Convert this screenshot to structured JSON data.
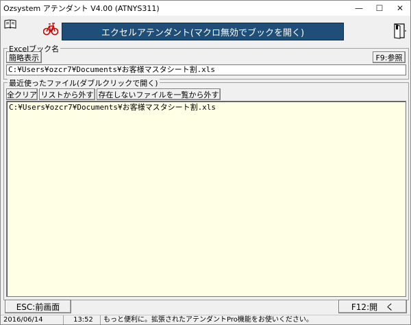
{
  "window": {
    "title": "Ozsystem アテンダント V4.00 (ATNYS311)",
    "buttons": {
      "minimize": "—",
      "maximize": "☐",
      "close": "✕"
    }
  },
  "toolbar": {
    "banner": "エクセルアテンダント(マクロ無効でブックを開く)",
    "icons": [
      "book-icon",
      "bicycle-icon",
      "door-icon"
    ]
  },
  "excel_group": {
    "legend": "Excelブック名",
    "simple_view_button": "簡略表示",
    "browse_button": "F9:参照",
    "path_value": "C:¥Users¥ozcr7¥Documents¥お客様マスタシート割.xls"
  },
  "recent_group": {
    "legend": "最近使ったファイル(ダブルクリックで開く)",
    "buttons": [
      "全クリア",
      "リストから外す",
      "存在しないファイルを一覧から外す"
    ],
    "items": [
      "C:¥Users¥ozcr7¥Documents¥お客様マスタシート割.xls"
    ]
  },
  "footer": {
    "esc_button": "ESC:前画面",
    "open_button": "F12:開　く"
  },
  "status": {
    "date": "2016/06/14",
    "time": "13:52",
    "message": "もっと便利に。拡張されたアテンダントPro機能をお使いください。"
  },
  "colors": {
    "banner_bg": "#1f4e78",
    "list_bg": "#ffffe6",
    "bike_red": "#cc0000"
  }
}
